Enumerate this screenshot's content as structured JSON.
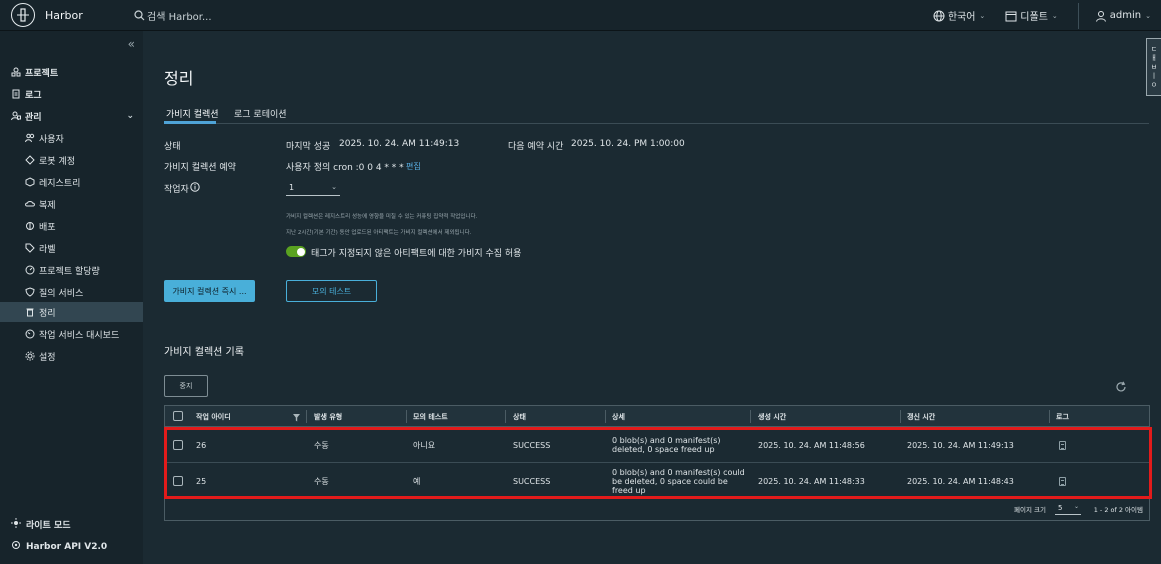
{
  "header": {
    "app_name": "Harbor",
    "search_placeholder": "검색 Harbor...",
    "language": "한국어",
    "theme": "디폴트",
    "user": "admin"
  },
  "sidebar": {
    "items": [
      {
        "label": "프로젝트",
        "icon": "projects-icon"
      },
      {
        "label": "로그",
        "icon": "logs-icon"
      },
      {
        "label": "관리",
        "icon": "admin-icon"
      },
      {
        "label": "사용자",
        "icon": "users-icon"
      },
      {
        "label": "로봇 계정",
        "icon": "robot-icon"
      },
      {
        "label": "레지스트리",
        "icon": "registry-icon"
      },
      {
        "label": "복제",
        "icon": "replication-icon"
      },
      {
        "label": "배포",
        "icon": "distribution-icon"
      },
      {
        "label": "라벨",
        "icon": "label-icon"
      },
      {
        "label": "프로젝트 할당량",
        "icon": "quota-icon"
      },
      {
        "label": "질의 서비스",
        "icon": "shield-icon"
      },
      {
        "label": "정리",
        "icon": "trash-icon"
      },
      {
        "label": "작업 서비스 대시보드",
        "icon": "dashboard-icon"
      },
      {
        "label": "설정",
        "icon": "gear-icon"
      }
    ],
    "light_mode": "라이트 모드",
    "api": "Harbor API V2.0"
  },
  "side_tab": [
    "ㄷ",
    "ㅐ",
    "ㅂ",
    "ㅣ",
    "ㅇ"
  ],
  "main": {
    "title": "정리",
    "tabs": [
      "가비지 컬렉션",
      "로그 로테이션"
    ],
    "status_label": "상태",
    "last_success_label": "마지막 성공",
    "last_success_value": "2025. 10. 24. AM 11:49:13",
    "next_schedule_label": "다음 예약 시간",
    "next_schedule_value": "2025. 10. 24. PM 1:00:00",
    "schedule_label": "가비지 컬렉션 예약",
    "schedule_value": "사용자 정의 cron :0 0 4 * * *",
    "edit_label": "편집",
    "workers_label": "작업자",
    "workers_value": "1",
    "note1": "가비지 컬렉션은 레지스트리 성능에 영향을 미칠 수 있는 커퓨팅 집약적 작업입니다.",
    "note2": "지난 2시간(기본 기간) 동안 업로드된 아티팩트는 가비지 컬렉션에서 제외됩니다.",
    "toggle_label": "태그가 지정되지 않은 아티팩트에 대한 가비지 수집 허용",
    "toggle_on": true,
    "run_now_label": "가비지 컬렉션 즉시 ...",
    "dry_run_label": "모의 테스트",
    "history_title": "가비지 컬렉션 기록",
    "stop_label": "중지"
  },
  "table": {
    "headers": [
      "작업 아이디",
      "발생 유형",
      "모의 테스트",
      "상태",
      "상세",
      "생성 시간",
      "갱신 시간",
      "로그"
    ],
    "rows": [
      {
        "id": "26",
        "trigger": "수동",
        "dry_run": "아니요",
        "status": "SUCCESS",
        "detail1": "0 blob(s) and 0 manifest(s)",
        "detail2": "deleted, 0 space freed up",
        "detail3": "",
        "created": "2025. 10. 24. AM 11:48:56",
        "updated": "2025. 10. 24. AM 11:49:13"
      },
      {
        "id": "25",
        "trigger": "수동",
        "dry_run": "예",
        "status": "SUCCESS",
        "detail1": "0 blob(s) and 0 manifest(s) could",
        "detail2": "be deleted, 0 space could be",
        "detail3": "freed up",
        "created": "2025. 10. 24. AM 11:48:33",
        "updated": "2025. 10. 24. AM 11:48:43"
      }
    ],
    "page_size_label": "페이지 크기",
    "page_size": "5",
    "count": "1 - 2 of 2 아이템"
  },
  "colors": {
    "accent": "#49afd9",
    "highlight": "#e31b1b",
    "toggle": "#5aa220"
  }
}
